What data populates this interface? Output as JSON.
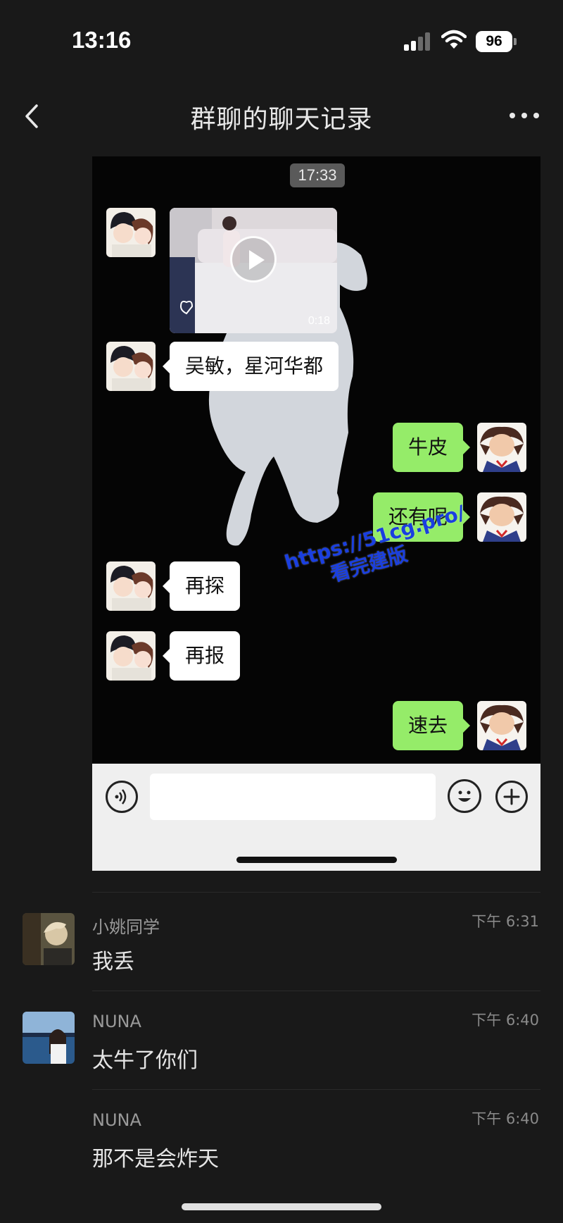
{
  "status_bar": {
    "time": "13:16",
    "battery": "96"
  },
  "nav": {
    "title": "群聊的聊天记录"
  },
  "screenshot": {
    "timestamp": "17:33",
    "video_duration": "0:18",
    "messages": [
      {
        "side": "left",
        "text": "吴敏，星河华都"
      },
      {
        "side": "right",
        "text": "牛皮"
      },
      {
        "side": "right",
        "text": "还有呢"
      },
      {
        "side": "left",
        "text": "再探"
      },
      {
        "side": "left",
        "text": "再报"
      },
      {
        "side": "right",
        "text": "速去"
      }
    ],
    "watermark": {
      "line1": "https://51cg.pro/",
      "line2": "看完建版"
    }
  },
  "comments": [
    {
      "name": "小姚同学",
      "time": "下午 6:31",
      "text": "我丢"
    },
    {
      "name": "NUNA",
      "time": "下午 6:40",
      "text": "太牛了你们"
    },
    {
      "name": "NUNA",
      "time": "下午 6:40",
      "text": "那不是会炸天"
    }
  ]
}
